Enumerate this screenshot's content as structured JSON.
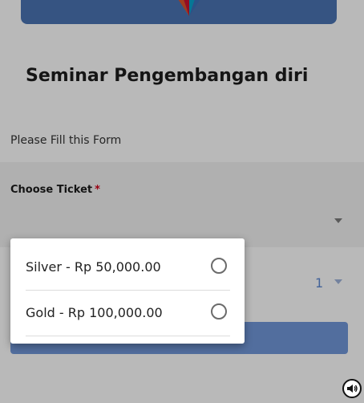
{
  "form": {
    "title": "Seminar Pengembangan diri",
    "subtitle": "Please Fill this Form",
    "ticket_label": "Choose Ticket",
    "required_marker": "*",
    "quantity_value": "1"
  },
  "ticket_options": [
    {
      "label": "Silver - Rp 50,000.00",
      "selected": false
    },
    {
      "label": "Gold - Rp 100,000.00",
      "selected": false
    }
  ],
  "colors": {
    "banner": "#4a72b0",
    "accent": "#6f95d6",
    "required": "#d0021b"
  },
  "icons": {
    "sound": "speaker-icon",
    "select_arrow": "chevron-down-icon"
  }
}
